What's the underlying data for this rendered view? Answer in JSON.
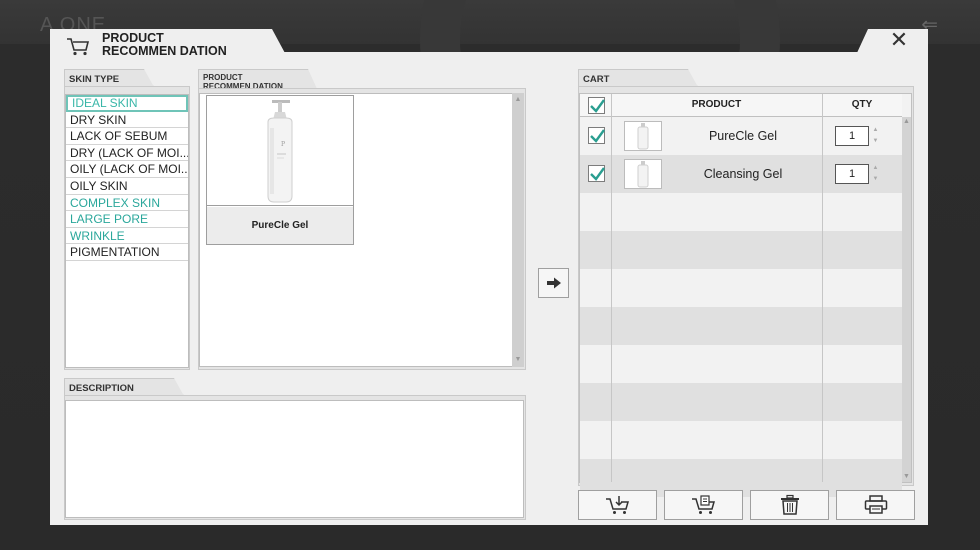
{
  "background": {
    "logo_text": "A ONE",
    "back_icon": "back-arrow-icon"
  },
  "dialog": {
    "title_line1": "PRODUCT",
    "title_line2": "RECOMMEN DATION",
    "close_icon": "close-icon"
  },
  "skin_type": {
    "label": "SKIN TYPE",
    "items": [
      {
        "label": "IDEAL SKIN",
        "state": "selected"
      },
      {
        "label": "DRY SKIN",
        "state": "normal"
      },
      {
        "label": "LACK OF SEBUM",
        "state": "normal"
      },
      {
        "label": "DRY (LACK OF MOI...",
        "state": "normal"
      },
      {
        "label": "OILY (LACK OF MOI...",
        "state": "normal"
      },
      {
        "label": "OILY SKIN",
        "state": "normal"
      },
      {
        "label": "COMPLEX SKIN",
        "state": "teal"
      },
      {
        "label": "LARGE PORE",
        "state": "teal"
      },
      {
        "label": "WRINKLE",
        "state": "teal"
      },
      {
        "label": "PIGMENTATION",
        "state": "normal"
      }
    ]
  },
  "recommendation": {
    "label_line1": "PRODUCT",
    "label_line2": "RECOMMEN DATION",
    "products": [
      {
        "name": "PureCle Gel"
      }
    ]
  },
  "description": {
    "label": "DESCRIPTION",
    "text": ""
  },
  "cart": {
    "label": "CART",
    "col_product": "PRODUCT",
    "col_qty": "QTY",
    "items": [
      {
        "name": "PureCle Gel",
        "qty": "1",
        "checked": true
      },
      {
        "name": "Cleansing Gel",
        "qty": "1",
        "checked": true
      }
    ]
  },
  "actions": [
    {
      "name": "add-to-cart-button",
      "icon": "cart-download-icon"
    },
    {
      "name": "cart-list-button",
      "icon": "cart-document-icon"
    },
    {
      "name": "delete-button",
      "icon": "trash-icon"
    },
    {
      "name": "print-button",
      "icon": "printer-icon"
    }
  ],
  "colors": {
    "accent": "#2aa79b",
    "check": "#2a9e90"
  }
}
